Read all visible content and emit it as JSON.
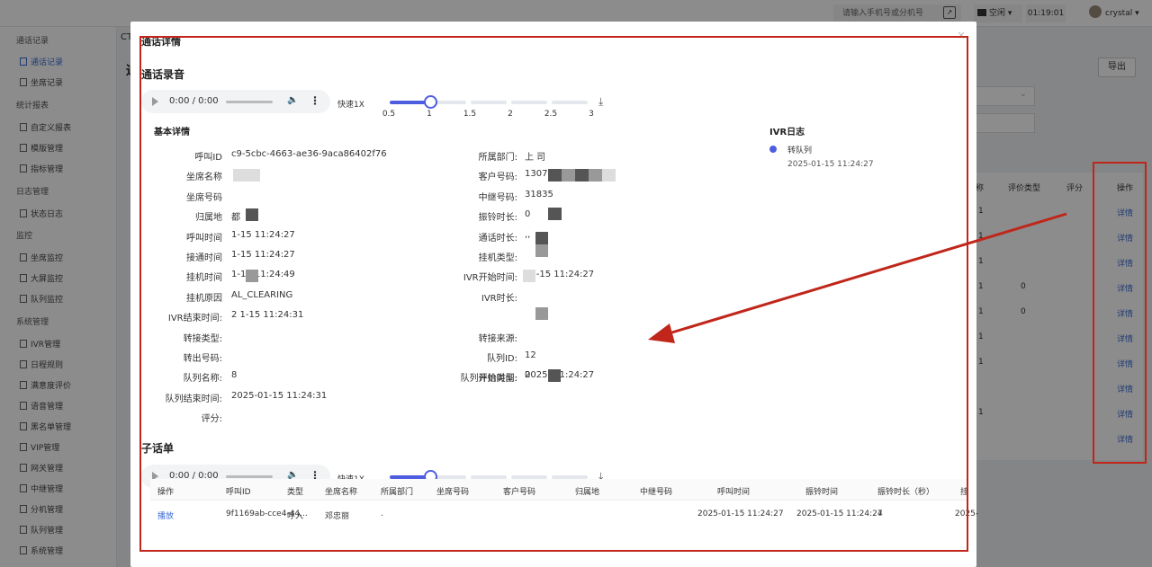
{
  "topbar": {
    "search_placeholder": "请输入手机号或分机号",
    "ext_icon": "↗",
    "status": "空闲",
    "timer": "01:19:01",
    "user": "crystal"
  },
  "sidebar": {
    "groups": [
      "通话记录",
      "统计报表",
      "日志管理",
      "监控",
      "系统管理"
    ],
    "items": [
      "通话记录",
      "坐席记录",
      "自定义报表",
      "模版管理",
      "指标管理",
      "状态日志",
      "坐席监控",
      "大屏监控",
      "队列监控",
      "IVR管理",
      "日程规则",
      "满意度评价",
      "语音管理",
      "黑名单管理",
      "VIP管理",
      "网关管理",
      "中继管理",
      "分机管理",
      "队列管理",
      "系统管理"
    ]
  },
  "background": {
    "crumb": "CT",
    "page_title": "通",
    "export": "导出",
    "columns": [
      "称",
      "评价类型",
      "评分",
      "操作"
    ],
    "col1_values": [
      "1",
      "1",
      "1",
      "1",
      "1",
      "1",
      "1",
      "1"
    ],
    "col2_values": [
      "0",
      "0"
    ],
    "links": [
      "详情",
      "详情",
      "详情",
      "详情",
      "详情",
      "详情",
      "详情",
      "详情",
      "详情",
      "详情"
    ]
  },
  "modal": {
    "title": "通话详情",
    "close": "×",
    "recording_title": "通话录音",
    "sub_title": "子话单",
    "basic_title": "基本详情",
    "ivr_title": "IVR日志",
    "ivr_item": "转队列",
    "ivr_time": "2025-01-15 11:24:27"
  },
  "audio": {
    "time": "0:00 / 0:00",
    "speed_label": "快速1X",
    "ticks": [
      "0.5",
      "1",
      "1.5",
      "2",
      "2.5",
      "3"
    ],
    "speed_value": 1,
    "speed_min": 0.5,
    "speed_max": 3,
    "download_icon": "⤓",
    "volume_icon": "🔈",
    "more_icon": "⋮"
  },
  "details_left": [
    {
      "label": "呼叫ID",
      "value": "c9-5cbc-4663-ae36-9aca86402f76"
    },
    {
      "label": "坐席名称",
      "value": ""
    },
    {
      "label": "坐席号码",
      "value": ""
    },
    {
      "label": "归属地",
      "value": "都"
    },
    {
      "label": "呼叫时间",
      "value": "1-15 11:24:27"
    },
    {
      "label": "接通时间",
      "value": "1-15 11:24:27"
    },
    {
      "label": "挂机时间",
      "value": "1-15 11:24:49"
    },
    {
      "label": "挂机原因",
      "value": "AL_CLEARING"
    },
    {
      "label": "IVR结束时间:",
      "value": "2    1-15 11:24:31"
    },
    {
      "label": "转接类型:",
      "value": ""
    },
    {
      "label": "转出号码:",
      "value": ""
    },
    {
      "label": "队列名称:",
      "value": "8"
    },
    {
      "label": "队列结束时间:",
      "value": "2025-01-15 11:24:31"
    },
    {
      "label": "评分:",
      "value": ""
    }
  ],
  "details_right": [
    {
      "label": "所属部门:",
      "value": "上                              司"
    },
    {
      "label": "客户号码:",
      "value": "13076              0"
    },
    {
      "label": "中继号码:",
      "value": "31835"
    },
    {
      "label": "振铃时长:",
      "value": "0"
    },
    {
      "label": "通话时长:",
      "value": "         ,,"
    },
    {
      "label": "挂机类型:",
      "value": ""
    },
    {
      "label": "IVR开始时间:",
      "value": "01-15 11:24:27"
    },
    {
      "label": "IVR时长:",
      "value": ""
    },
    {
      "label": "转接来源:",
      "value": ""
    },
    {
      "label": "队列ID:",
      "value": "12"
    },
    {
      "label": "队列开始时间:",
      "value": "2025-          11:24:27"
    },
    {
      "label": "评价类型:",
      "value": "0"
    }
  ],
  "sub_table": {
    "headers": [
      "操作",
      "呼叫ID",
      "类型",
      "坐席名称",
      "所属部门",
      "坐席号码",
      "客户号码",
      "归属地",
      "中继号码",
      "呼叫时间",
      "振铃时间",
      "振铃时长（秒）",
      "挂"
    ],
    "row": [
      "播放",
      "9f1169ab-cce4-44...",
      "呼入",
      "邓忠丽",
      ".",
      "",
      "",
      "",
      "",
      "2025-01-15 11:24:27",
      "2025-01-15 11:24:27",
      "4",
      "2025-"
    ]
  }
}
